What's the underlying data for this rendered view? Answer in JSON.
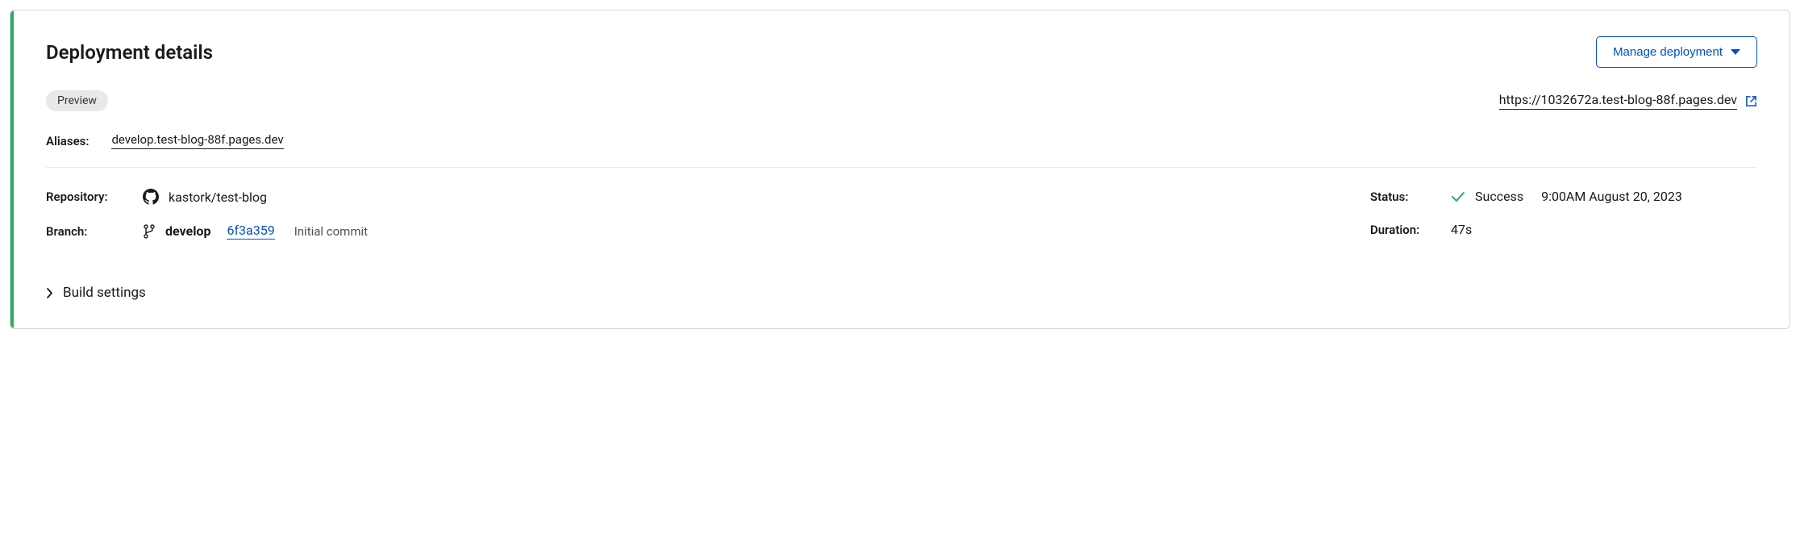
{
  "header": {
    "title": "Deployment details",
    "manage_button": "Manage deployment"
  },
  "preview": {
    "badge": "Preview",
    "url": "https://1032672a.test-blog-88f.pages.dev"
  },
  "aliases": {
    "label": "Aliases:",
    "value": "develop.test-blog-88f.pages.dev"
  },
  "repository": {
    "label": "Repository:",
    "value": "kastork/test-blog"
  },
  "branch": {
    "label": "Branch:",
    "name": "develop",
    "commit": "6f3a359",
    "message": "Initial commit"
  },
  "status": {
    "label": "Status:",
    "value": "Success",
    "timestamp": "9:00AM August 20, 2023"
  },
  "duration": {
    "label": "Duration:",
    "value": "47s"
  },
  "build_settings": {
    "label": "Build settings"
  }
}
